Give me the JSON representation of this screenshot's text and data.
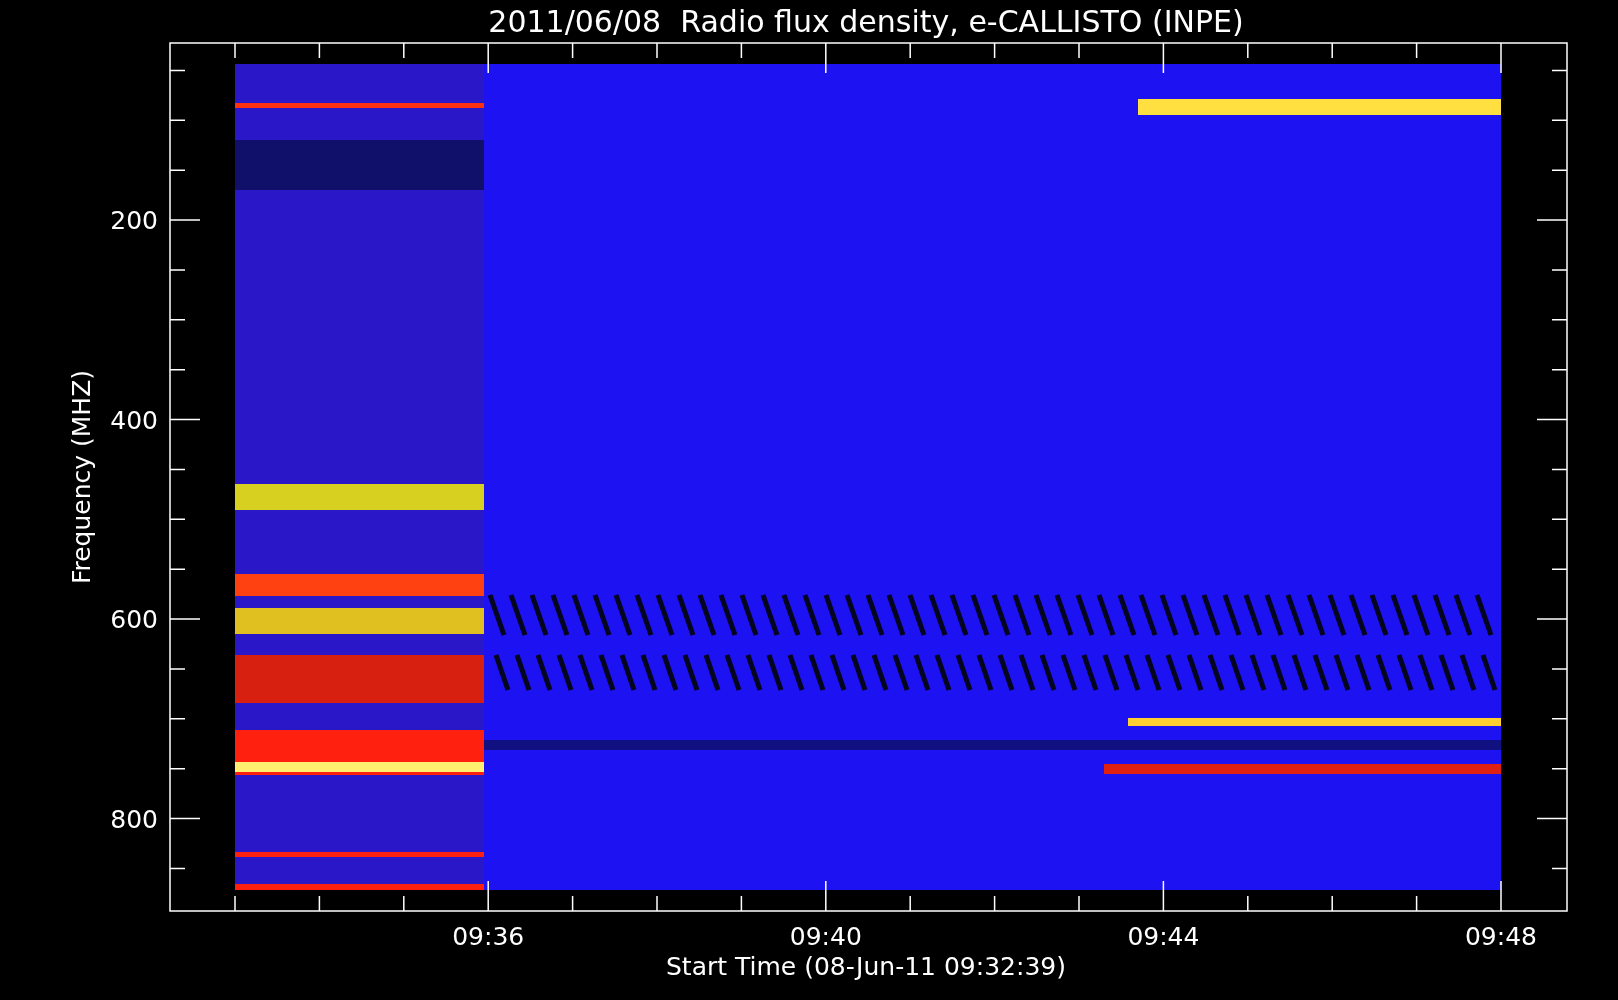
{
  "plot": {
    "title": "2011/06/08  Radio flux density, e-CALLISTO (INPE)",
    "ylabel": "Frequency (MHZ)",
    "xlabel": "Start Time (08-Jun-11 09:32:39)",
    "yticks": [
      "200",
      "400",
      "600",
      "800"
    ],
    "xticks": [
      "09:36",
      "09:40",
      "09:44",
      "09:48"
    ]
  }
}
